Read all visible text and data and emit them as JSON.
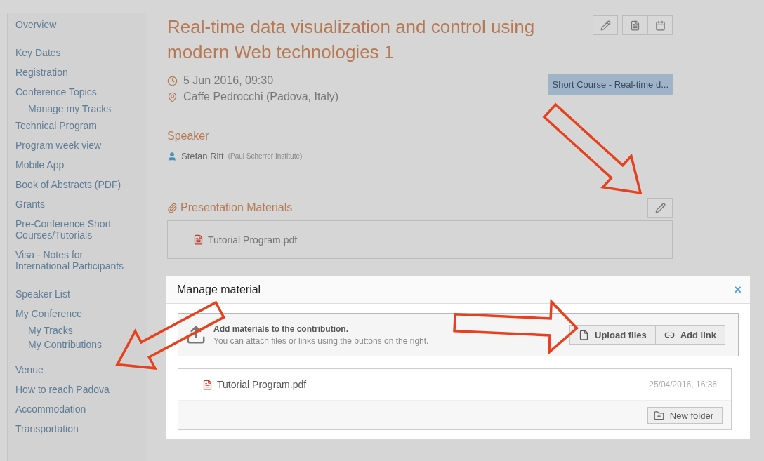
{
  "sidebar": {
    "groups": [
      [
        {
          "label": "Overview"
        }
      ],
      [
        {
          "label": "Key Dates"
        },
        {
          "label": "Registration"
        },
        {
          "label": "Conference Topics",
          "children": [
            {
              "label": "Manage my Tracks"
            }
          ]
        },
        {
          "label": "Technical Program"
        },
        {
          "label": "Program week view"
        },
        {
          "label": "Mobile App"
        },
        {
          "label": "Book of Abstracts (PDF)"
        },
        {
          "label": "Grants"
        },
        {
          "label": "Pre-Conference Short Courses/Tutorials"
        },
        {
          "label": "Visa - Notes for International Participants"
        }
      ],
      [
        {
          "label": "Speaker List"
        },
        {
          "label": "My Conference",
          "children": [
            {
              "label": "My Tracks"
            },
            {
              "label": "My Contributions"
            }
          ]
        }
      ],
      [
        {
          "label": "Venue"
        },
        {
          "label": "How to reach Padova"
        },
        {
          "label": "Accommodation"
        },
        {
          "label": "Transportation"
        }
      ]
    ]
  },
  "contribution": {
    "title": "Real-time data visualization and control using modern Web technologies 1",
    "date": "5 Jun 2016, 09:30",
    "location": "Caffe Pedrocchi (Padova, Italy)",
    "session_tag": "Short Course - Real-time d...",
    "speaker_heading": "Speaker",
    "speaker": {
      "name": "Stefan Ritt",
      "affiliation": "(Paul Scherrer Institute)"
    },
    "materials_heading": "Presentation Materials",
    "materials": [
      {
        "name": "Tutorial Program.pdf"
      }
    ]
  },
  "modal": {
    "title": "Manage material",
    "close": "×",
    "info_title": "Add materials to the contribution.",
    "info_text": "You can attach files or links using the buttons on the right.",
    "buttons": [
      {
        "kind": "file",
        "label": "Upload files"
      },
      {
        "kind": "link",
        "label": "Add link"
      }
    ],
    "files": [
      {
        "name": "Tutorial Program.pdf",
        "date": "25/04/2016, 16:36"
      }
    ],
    "footer_button": "New folder"
  }
}
